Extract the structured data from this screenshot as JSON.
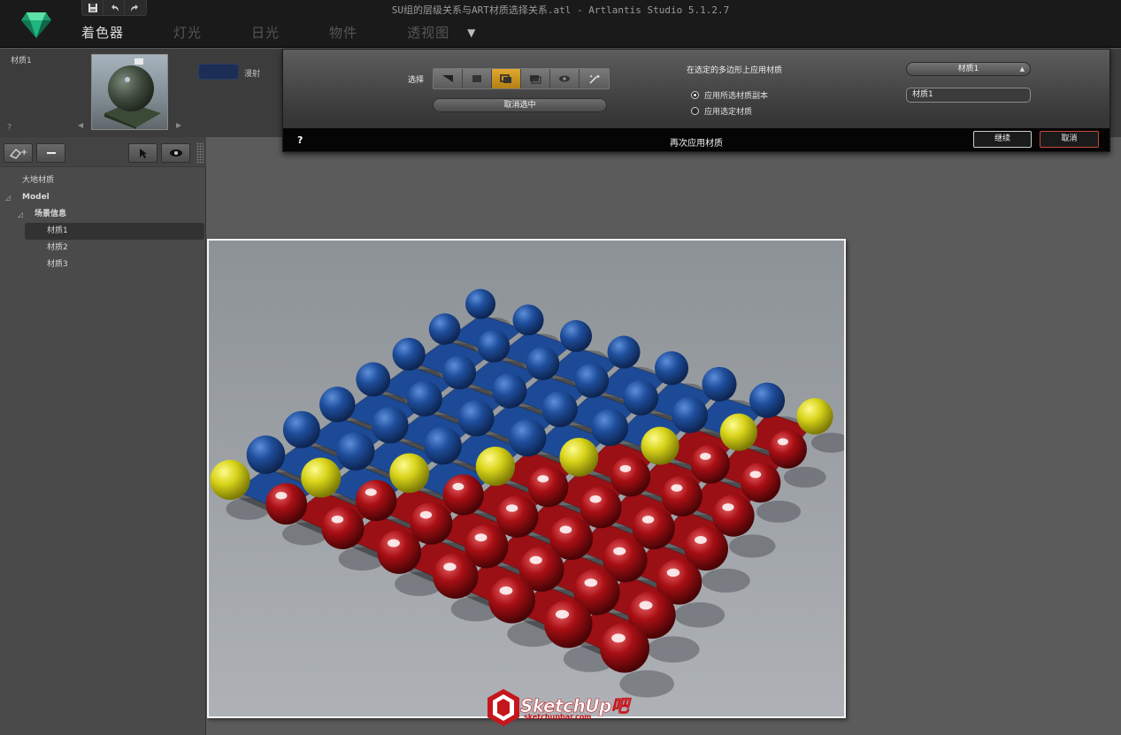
{
  "window": {
    "title": "SU组的层级关系与ART材质选择关系.atl - Artlantis Studio 5.1.2.7"
  },
  "quickbar": {
    "icons": [
      "save-icon",
      "undo-icon",
      "redo-icon"
    ]
  },
  "tabs": [
    {
      "label": "着色器",
      "active": true
    },
    {
      "label": "灯光",
      "active": false
    },
    {
      "label": "日光",
      "active": false
    },
    {
      "label": "物件",
      "active": false
    },
    {
      "label": "透视图",
      "active": false
    }
  ],
  "preview": {
    "material_name": "材质1",
    "help": "?",
    "reflection_label": "漫射"
  },
  "overlay": {
    "select_label": "选择",
    "tools": [
      "select-polygon",
      "select-face",
      "select-group",
      "select-object",
      "select-layer",
      "magic-select"
    ],
    "active_tool": 2,
    "deselect_label": "取消选中",
    "apply_title": "在选定的多边形上应用材质",
    "option_copy": "应用所选材质副本",
    "option_selected": "应用选定材质",
    "selected_option": "copy",
    "material_dropdown": "材质1",
    "material_field": "材质1",
    "help": "?",
    "reapply_label": "再次应用材质",
    "continue_label": "继续",
    "cancel_label": "取消"
  },
  "tree": {
    "items": [
      {
        "label": "大地材质",
        "level": 0,
        "bold": false,
        "expander": false
      },
      {
        "label": "Model",
        "level": 0,
        "bold": true,
        "expander": true
      },
      {
        "label": "场景信息",
        "level": 1,
        "bold": true,
        "expander": true
      },
      {
        "label": "材质1",
        "level": 2,
        "bold": false,
        "expander": false,
        "selected": true
      },
      {
        "label": "材质2",
        "level": 2,
        "bold": false,
        "expander": false
      },
      {
        "label": "材质3",
        "level": 2,
        "bold": false,
        "expander": false
      }
    ]
  },
  "watermark": {
    "brand": "SketchUp吧",
    "url": "sketchupbar.com"
  },
  "colors": {
    "blue": "#1f4e9c",
    "red": "#a80f14",
    "yellow": "#d8d41a",
    "accent": "#d69a22"
  }
}
